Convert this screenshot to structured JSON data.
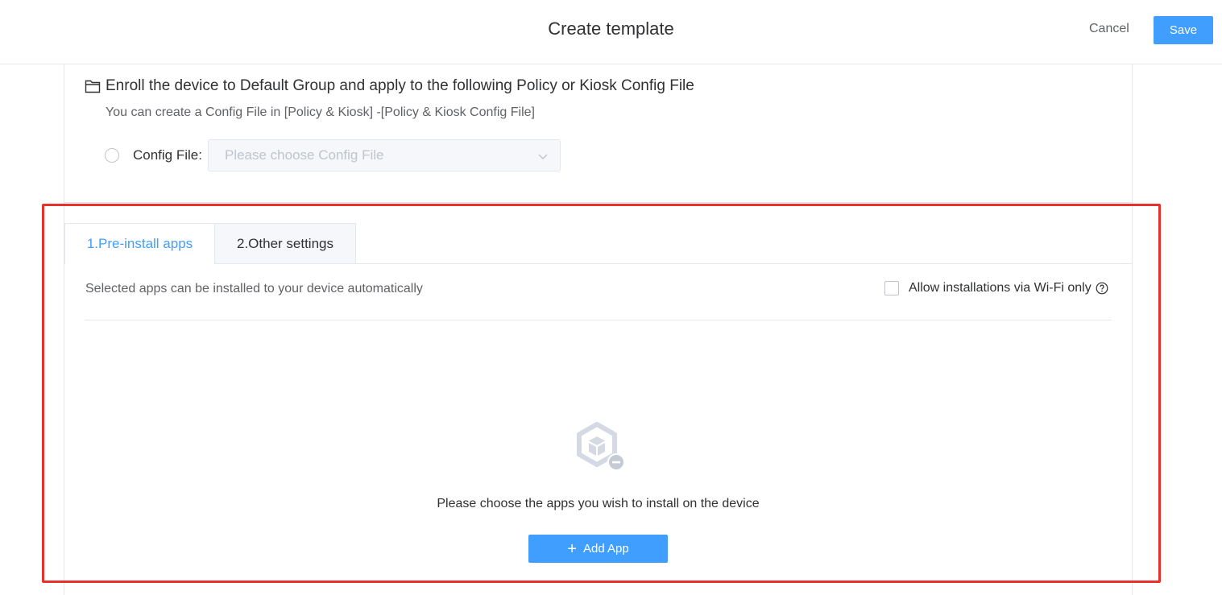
{
  "header": {
    "title": "Create template",
    "cancel_label": "Cancel",
    "save_label": "Save"
  },
  "enroll": {
    "title": "Enroll the device to Default Group and apply to the following Policy or Kiosk Config File",
    "hint": "You can create a Config File in [Policy & Kiosk] -[Policy & Kiosk Config File]",
    "config_label": "Config File:",
    "config_placeholder": "Please choose Config File"
  },
  "tabs": [
    {
      "label": "1.Pre-install apps",
      "active": true
    },
    {
      "label": "2.Other settings",
      "active": false
    }
  ],
  "preinstall": {
    "description": "Selected apps can be installed to your device automatically",
    "wifi_only_label": "Allow installations via Wi-Fi only",
    "wifi_only_checked": false,
    "empty_text": "Please choose the apps you wish to install on the device",
    "add_app_label": "Add App"
  },
  "icons": {
    "folder": "folder-icon",
    "help": "help-circle-icon",
    "empty": "app-package-remove-icon",
    "chevron": "chevron-down-icon",
    "plus": "plus-icon"
  },
  "colors": {
    "accent": "#409eff",
    "highlight_border": "#e8302c"
  }
}
